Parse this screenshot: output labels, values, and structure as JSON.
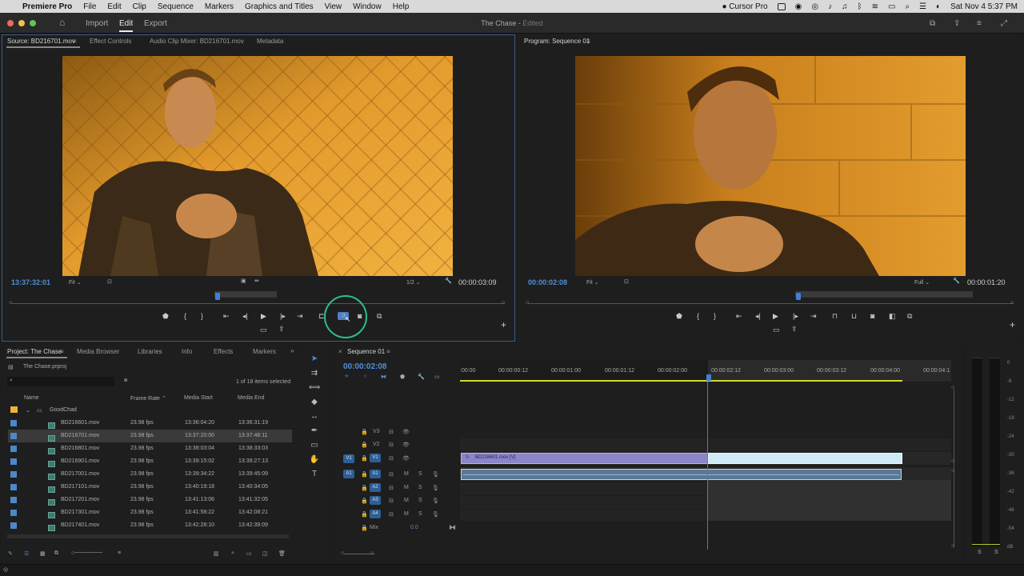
{
  "menubar": {
    "apple": "",
    "app_name": "Premiere Pro",
    "items": [
      "File",
      "Edit",
      "Clip",
      "Sequence",
      "Markers",
      "Graphics and Titles",
      "View",
      "Window",
      "Help"
    ],
    "cursor_app": "Cursor Pro",
    "datetime": "Sat Nov 4  5:37 PM"
  },
  "titlebar": {
    "workspaces": [
      "Import",
      "Edit",
      "Export"
    ],
    "doc_title": "The Chase",
    "doc_status": "Edited"
  },
  "source_monitor": {
    "tabs": [
      "Source: BD216701.mov",
      "Effect Controls",
      "Audio Clip Mixer: BD216701.mov",
      "Metadata"
    ],
    "timecode": "13:37:32:01",
    "fit": "Fit",
    "resolution": "1/2",
    "duration": "00:00:03:09"
  },
  "program_monitor": {
    "tab": "Program: Sequence 01",
    "timecode": "00:00:02:08",
    "fit": "Fit",
    "resolution": "Full",
    "duration": "00:00:01:20"
  },
  "project_panel": {
    "tabs": [
      "Project: The Chase",
      "Media Browser",
      "Libraries",
      "Info",
      "Effects",
      "Markers"
    ],
    "file": "The Chase.prproj",
    "selection_count": "1 of 18 items selected",
    "columns": [
      "Name",
      "Frame Rate",
      "Media Start",
      "Media End"
    ],
    "folder": "GoodChad",
    "items": [
      {
        "name": "BD216601.mov",
        "fps": "23.98 fps",
        "start": "13:36:04:20",
        "end": "13:36:31:19"
      },
      {
        "name": "BD216701.mov",
        "fps": "23.98 fps",
        "start": "13:37:20:00",
        "end": "13:37:48:11"
      },
      {
        "name": "BD216801.mov",
        "fps": "23.98 fps",
        "start": "13:38:03:04",
        "end": "13:38:33:03"
      },
      {
        "name": "BD216901.mov",
        "fps": "23.98 fps",
        "start": "13:39:15:02",
        "end": "13:39:27:13"
      },
      {
        "name": "BD217001.mov",
        "fps": "23.98 fps",
        "start": "13:39:34:22",
        "end": "13:39:45:09"
      },
      {
        "name": "BD217101.mov",
        "fps": "23.98 fps",
        "start": "13:40:19:18",
        "end": "13:40:34:05"
      },
      {
        "name": "BD217201.mov",
        "fps": "23.98 fps",
        "start": "13:41:13:06",
        "end": "13:41:32:05"
      },
      {
        "name": "BD217301.mov",
        "fps": "23.98 fps",
        "start": "13:41:58:22",
        "end": "13:42:08:21"
      },
      {
        "name": "BD217401.mov",
        "fps": "23.98 fps",
        "start": "13:42:28:10",
        "end": "13:42:39:09"
      }
    ]
  },
  "timeline": {
    "tab": "Sequence 01",
    "timecode": "00:00:02:08",
    "ruler": [
      ":00:00",
      "00:00:00:12",
      "00:00:01:00",
      "00:00:01:12",
      "00:00:02:00",
      "00:00:02:12",
      "00:00:03:00",
      "00:00:03:12",
      "00:00:04:00",
      "00:00:04:1"
    ],
    "video_tracks": [
      "V3",
      "V2",
      "V1"
    ],
    "audio_tracks": [
      "A1",
      "A2",
      "A3",
      "A4"
    ],
    "source_v": "V1",
    "source_a": "A1",
    "mix_label": "Mix",
    "mix_value": "0.0",
    "clip_label": "BD216601.mov [V]",
    "fx_badge": "fx",
    "mute": "M",
    "solo": "S"
  },
  "meter": {
    "scale": [
      "0",
      "-6",
      "-12",
      "-18",
      "-24",
      "-30",
      "-36",
      "-42",
      "-48",
      "-54",
      "dB"
    ],
    "solo_left": "S",
    "solo_right": "S"
  },
  "colors": {
    "accent_blue": "#4f8fdc",
    "clip_video": "#8a86c8",
    "clip_video_selected": "#cfe9f6",
    "clip_audio": "#5b7896",
    "highlight_ring": "#2bbf8e"
  }
}
